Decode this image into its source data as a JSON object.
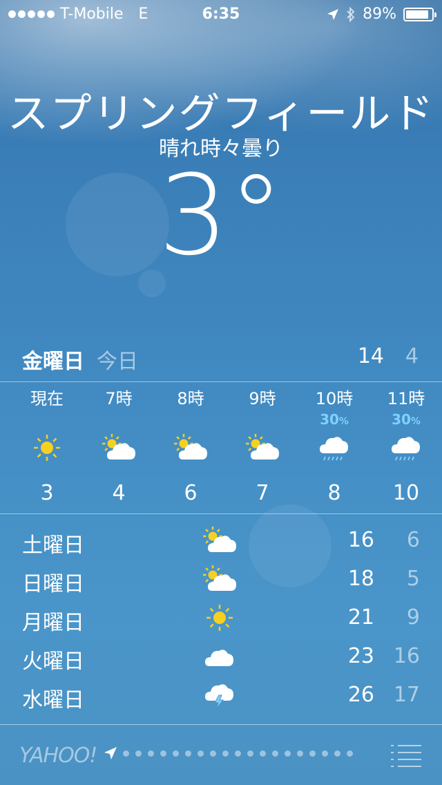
{
  "status_bar": {
    "carrier": "T-Mobile",
    "network": "E",
    "time": "6:35",
    "battery": "89%",
    "battery_level": 0.89
  },
  "city": "スプリングフィールド",
  "condition": "晴れ時々曇り",
  "temperature": "3°",
  "today": {
    "day": "金曜日",
    "label": "今日",
    "high": "14",
    "low": "4"
  },
  "hourly": [
    {
      "time": "現在",
      "chance": "",
      "icon": "sun-icon",
      "temp": "3"
    },
    {
      "time": "7時",
      "chance": "",
      "icon": "partly-cloudy-icon",
      "temp": "4"
    },
    {
      "time": "8時",
      "chance": "",
      "icon": "partly-cloudy-icon",
      "temp": "6"
    },
    {
      "time": "9時",
      "chance": "",
      "icon": "partly-cloudy-icon",
      "temp": "7"
    },
    {
      "time": "10時",
      "chance": "30",
      "icon": "rain-icon",
      "temp": "8"
    },
    {
      "time": "11時",
      "chance": "30",
      "icon": "rain-icon",
      "temp": "10"
    }
  ],
  "percent_sign": "%",
  "daily": [
    {
      "day": "土曜日",
      "icon": "partly-cloudy-icon",
      "high": "16",
      "low": "6"
    },
    {
      "day": "日曜日",
      "icon": "partly-cloudy-icon",
      "high": "18",
      "low": "5"
    },
    {
      "day": "月曜日",
      "icon": "sun-icon",
      "high": "21",
      "low": "9"
    },
    {
      "day": "火曜日",
      "icon": "cloud-icon",
      "high": "23",
      "low": "16"
    },
    {
      "day": "水曜日",
      "icon": "thunderstorm-icon",
      "high": "26",
      "low": "17"
    }
  ],
  "footer": {
    "brand": "YAHOO!",
    "page_count": 19
  },
  "colors": {
    "sun": "#f5d020",
    "precip": "#7fd0ff"
  }
}
